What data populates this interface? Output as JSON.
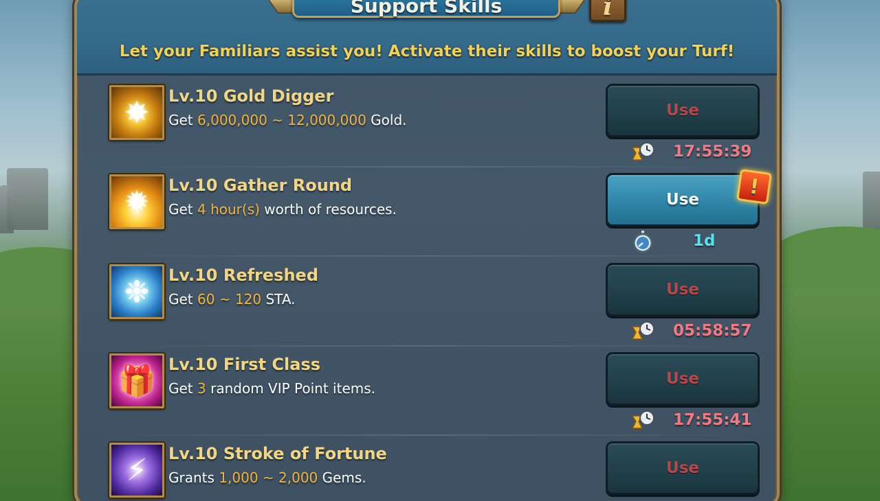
{
  "window": {
    "title": "Support Skills",
    "subtitle": "Let your Familiars assist you!  Activate their skills to boost your Turf!"
  },
  "icons": {
    "info": "info-icon",
    "hourglass": "hourglass-clock-icon",
    "stopwatch": "stopwatch-icon",
    "alert": "exclamation-alert-icon"
  },
  "colors": {
    "highlight": "#f6b43b",
    "cooldown": "#f07a82",
    "ready": "#55e2ee",
    "disabled_label": "#b8474a"
  },
  "skills": [
    {
      "name": "Lv.10 Gold Digger",
      "desc_pre": "Get ",
      "desc_hl": "6,000,000 ~ 12,000,000",
      "desc_post": " Gold.",
      "button": "Use",
      "state": "cooldown",
      "timer": "17:55:39",
      "icon": "gold-digger-icon"
    },
    {
      "name": "Lv.10 Gather Round",
      "desc_pre": "Get ",
      "desc_hl": "4 hour(s)",
      "desc_post": " worth of resources.",
      "button": "Use",
      "state": "ready",
      "timer": "1d",
      "icon": "gather-round-icon"
    },
    {
      "name": "Lv.10 Refreshed",
      "desc_pre": "Get ",
      "desc_hl": "60 ~ 120",
      "desc_post": " STA.",
      "button": "Use",
      "state": "cooldown",
      "timer": "05:58:57",
      "icon": "refreshed-icon"
    },
    {
      "name": "Lv.10 First Class",
      "desc_pre": "Get ",
      "desc_hl": "3",
      "desc_post": " random VIP Point items.",
      "button": "Use",
      "state": "cooldown",
      "timer": "17:55:41",
      "icon": "first-class-gift-icon"
    },
    {
      "name": "Lv.10 Stroke of Fortune",
      "desc_pre": "Grants ",
      "desc_hl": "1,000 ~ 2,000",
      "desc_post": " Gems.",
      "button": "Use",
      "state": "cooldown",
      "timer": "",
      "icon": "stroke-of-fortune-icon"
    }
  ]
}
